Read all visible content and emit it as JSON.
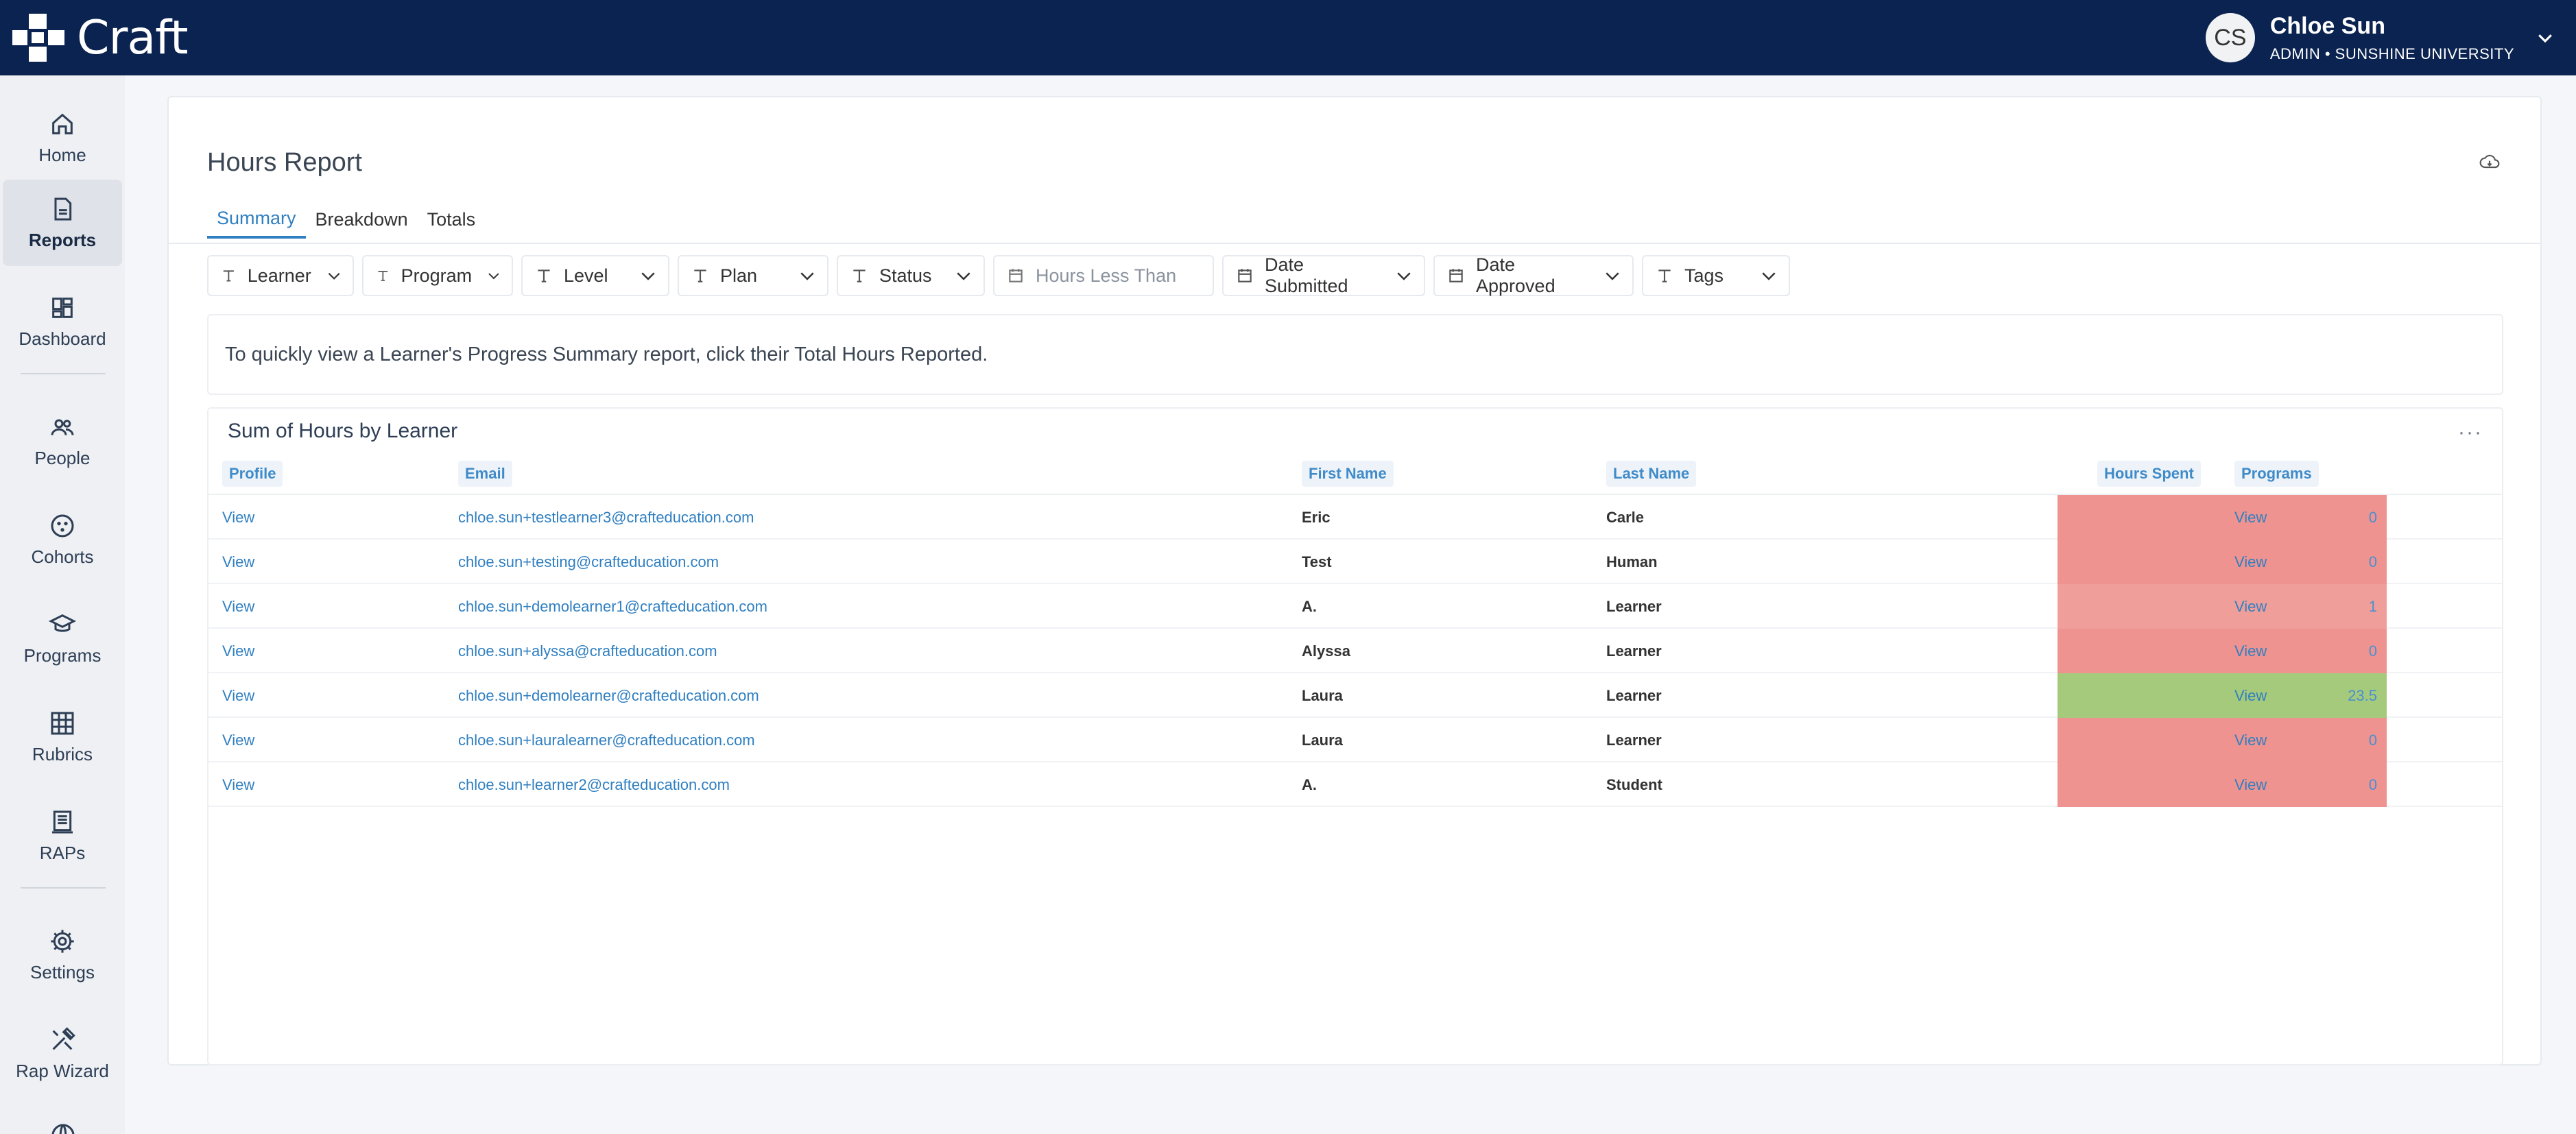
{
  "app": {
    "name": "Craft"
  },
  "user": {
    "initials": "CS",
    "name": "Chloe Sun",
    "role": "ADMIN • SUNSHINE UNIVERSITY"
  },
  "sidebar": {
    "items": [
      {
        "label": "Home",
        "icon": "home-icon"
      },
      {
        "label": "Reports",
        "icon": "report-icon",
        "active": true
      },
      {
        "label": "Dashboard",
        "icon": "dashboard-icon"
      },
      {
        "label": "People",
        "icon": "people-icon"
      },
      {
        "label": "Cohorts",
        "icon": "cohorts-icon"
      },
      {
        "label": "Programs",
        "icon": "graduation-cap-icon"
      },
      {
        "label": "Rubrics",
        "icon": "grid-icon"
      },
      {
        "label": "RAPs",
        "icon": "document-icon"
      },
      {
        "label": "Settings",
        "icon": "gear-icon"
      },
      {
        "label": "Rap Wizard",
        "icon": "tools-icon"
      }
    ]
  },
  "page": {
    "title": "Hours Report",
    "tabs": [
      "Summary",
      "Breakdown",
      "Totals"
    ],
    "active_tab": "Summary",
    "filters": [
      {
        "label": "Learner",
        "icon": "text-type-icon"
      },
      {
        "label": "Program",
        "icon": "text-type-icon"
      },
      {
        "label": "Level",
        "icon": "text-type-icon"
      },
      {
        "label": "Plan",
        "icon": "text-type-icon"
      },
      {
        "label": "Status",
        "icon": "text-type-icon"
      },
      {
        "label": "Hours Less Than",
        "icon": "calendar-icon"
      },
      {
        "label": "Date Submitted",
        "icon": "calendar-icon"
      },
      {
        "label": "Date Approved",
        "icon": "calendar-icon"
      },
      {
        "label": "Tags",
        "icon": "text-type-icon"
      }
    ],
    "info_text": "To quickly view a Learner's Progress Summary report, click their Total Hours Reported."
  },
  "report": {
    "title": "Sum of Hours by Learner",
    "more_label": "···",
    "columns": [
      "Profile",
      "Email",
      "First Name",
      "Last Name",
      "Hours Spent",
      "Programs"
    ],
    "rows": [
      {
        "profile": "View",
        "email": "chloe.sun+testlearner3@crafteducation.com",
        "first": "Eric",
        "last": "Carle",
        "hours": "0",
        "programs": "View",
        "color": "#ef9390"
      },
      {
        "profile": "View",
        "email": "chloe.sun+testing@crafteducation.com",
        "first": "Test",
        "last": "Human",
        "hours": "0",
        "programs": "View",
        "color": "#ef9390"
      },
      {
        "profile": "View",
        "email": "chloe.sun+demolearner1@crafteducation.com",
        "first": "A.",
        "last": "Learner",
        "hours": "1",
        "programs": "View",
        "color": "#f09e9a"
      },
      {
        "profile": "View",
        "email": "chloe.sun+alyssa@crafteducation.com",
        "first": "Alyssa",
        "last": "Learner",
        "hours": "0",
        "programs": "View",
        "color": "#ef9390"
      },
      {
        "profile": "View",
        "email": "chloe.sun+demolearner@crafteducation.com",
        "first": "Laura",
        "last": "Learner",
        "hours": "23.5",
        "programs": "View",
        "color": "#a5ca7c"
      },
      {
        "profile": "View",
        "email": "chloe.sun+lauralearner@crafteducation.com",
        "first": "Laura",
        "last": "Learner",
        "hours": "0",
        "programs": "View",
        "color": "#ef9390"
      },
      {
        "profile": "View",
        "email": "chloe.sun+learner2@crafteducation.com",
        "first": "A.",
        "last": "Student",
        "hours": "0",
        "programs": "View",
        "color": "#ef9390"
      }
    ]
  }
}
